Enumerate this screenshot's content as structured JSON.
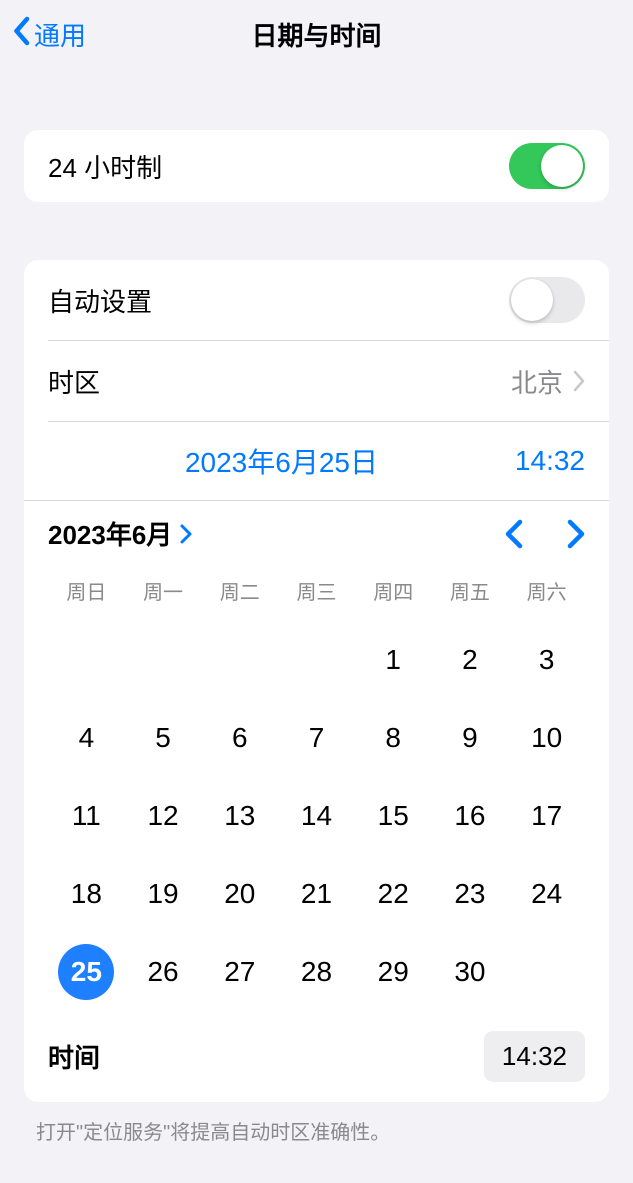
{
  "nav": {
    "back_label": "通用",
    "title": "日期与时间"
  },
  "twenty_four": {
    "label": "24 小时制",
    "on": true
  },
  "auto_set": {
    "label": "自动设置",
    "on": false
  },
  "timezone": {
    "label": "时区",
    "value": "北京"
  },
  "selected": {
    "date": "2023年6月25日",
    "time": "14:32"
  },
  "calendar": {
    "month_label": "2023年6月",
    "weekdays": [
      "周日",
      "周一",
      "周二",
      "周三",
      "周四",
      "周五",
      "周六"
    ],
    "leading_blanks": 4,
    "days": [
      1,
      2,
      3,
      4,
      5,
      6,
      7,
      8,
      9,
      10,
      11,
      12,
      13,
      14,
      15,
      16,
      17,
      18,
      19,
      20,
      21,
      22,
      23,
      24,
      25,
      26,
      27,
      28,
      29,
      30
    ],
    "selected_day": 25
  },
  "time_row": {
    "label": "时间",
    "value": "14:32"
  },
  "footer": "打开\"定位服务\"将提高自动时区准确性。"
}
